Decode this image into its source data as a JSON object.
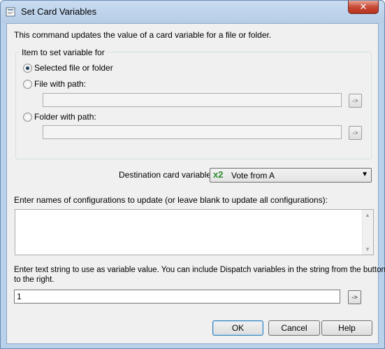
{
  "window": {
    "title": "Set Card Variables",
    "close_glyph": "✕"
  },
  "description": "This command updates the value of a card variable for a file or folder.",
  "item_group": {
    "legend": "Item to set variable for",
    "options": [
      {
        "label": "Selected file or folder",
        "checked": true
      },
      {
        "label": "File with path:",
        "checked": false
      },
      {
        "label": "Folder with path:",
        "checked": false
      }
    ],
    "file_path_value": "",
    "folder_path_value": "",
    "browse_glyph": "->"
  },
  "destination": {
    "label": "Destination card variable:",
    "variable_icon": "x2",
    "selected": "Vote from A",
    "dropdown_glyph": "▼"
  },
  "configurations": {
    "label": "Enter names of configurations to update (or leave blank to update all configurations):",
    "value": "",
    "scroll_up_glyph": "▲",
    "scroll_down_glyph": "▼"
  },
  "value_text": {
    "label_line1": "Enter text string to use as variable value. You can include Dispatch variables in the string from the button",
    "label_line2": "to the right.",
    "value": "1",
    "insert_glyph": "->"
  },
  "buttons": {
    "ok": "OK",
    "cancel": "Cancel",
    "help": "Help"
  },
  "icons": {
    "title": "card-icon",
    "close": "close-icon"
  }
}
